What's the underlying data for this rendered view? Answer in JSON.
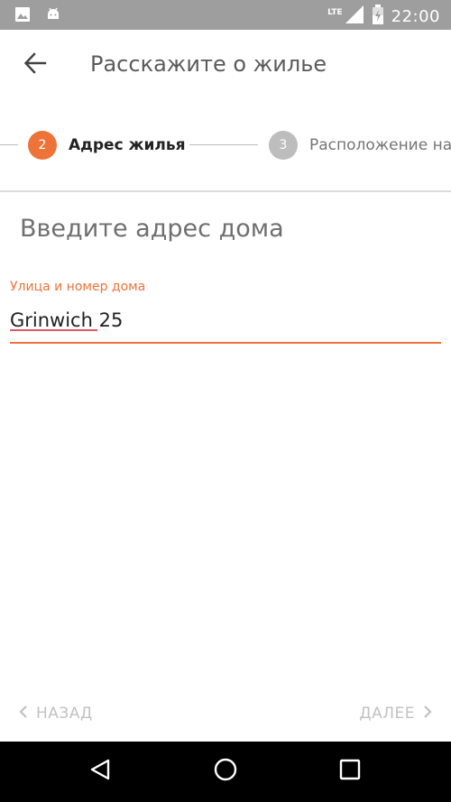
{
  "status_bar": {
    "time": "22:00",
    "network": "LTE",
    "icons": [
      "image-icon",
      "android-icon",
      "signal-icon",
      "battery-icon"
    ]
  },
  "app_bar": {
    "title": "Расскажите о жилье",
    "back_icon": "arrow-back-icon"
  },
  "stepper": {
    "steps": [
      {
        "number": "2",
        "label": "Адрес жилья",
        "active": true
      },
      {
        "number": "3",
        "label": "Расположение на",
        "active": false
      }
    ],
    "colors": {
      "active": "#ee7338",
      "inactive": "#bdbdbd"
    }
  },
  "form": {
    "heading": "Введите адрес дома",
    "street_label": "Улица и номер дома",
    "street_value": "Grinwich 25"
  },
  "footer": {
    "back_label": "НАЗАД",
    "next_label": "ДАЛЕЕ"
  },
  "colors": {
    "accent": "#ee7338",
    "status_bar": "#9e9e9e",
    "nav_bar": "#000000"
  }
}
